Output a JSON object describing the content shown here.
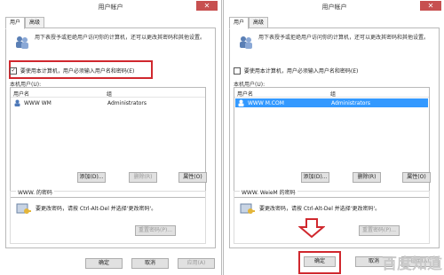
{
  "left": {
    "title": "用户帐户",
    "close": "✕",
    "tabs": [
      "用户",
      "高级"
    ],
    "description": "用下表授予或拒绝用户访问你的计算机，还可以更改其密码和其他设置。",
    "checkbox_label": "要使用本计算机，用户必须输入用户名和密码(E)",
    "checkbox_checked": true,
    "checkbox_mark": "✓",
    "section_label": "本机用户(U):",
    "col_user": "用户名",
    "col_group": "组",
    "user_name": "WWW      WM",
    "user_group": "Administrators",
    "btn_add": "添加(D)...",
    "btn_remove": "删除(R)",
    "btn_props": "属性(O)",
    "pw_title": "WWW.          的密码",
    "pw_desc": "要更改密码，请按 Ctrl-Alt-Del 并选择'更改密码'。",
    "btn_reset": "重置密码(P)...",
    "btn_ok": "确定",
    "btn_cancel": "取消",
    "btn_apply": "应用(A)"
  },
  "right": {
    "title": "用户帐户",
    "close": "✕",
    "tabs": [
      "用户",
      "高级"
    ],
    "description": "用下表授予或拒绝用户访问你的计算机，还可以更改其密码和其他设置。",
    "checkbox_label": "要使用本计算机，用户必须输入用户名和密码(E)",
    "checkbox_checked": false,
    "checkbox_mark": "",
    "section_label": "本机用户(U):",
    "col_user": "用户名",
    "col_group": "组",
    "user_name": "WWW      M.COM",
    "user_group": "Administrators",
    "btn_add": "添加(D)...",
    "btn_remove": "删除(R)",
    "btn_props": "属性(O)",
    "pw_title": "WWW.            WeieM 的密码",
    "pw_desc": "要更改密码，请按 Ctrl-Alt-Del 并选择'更改密码'。",
    "btn_reset": "重置密码(P)...",
    "btn_ok": "确定",
    "btn_cancel": "取消",
    "btn_apply": "应用(A)"
  },
  "watermark": "百度知道",
  "colors": {
    "highlight": "#d0282e",
    "selection": "#3399ff",
    "close": "#c75050"
  }
}
